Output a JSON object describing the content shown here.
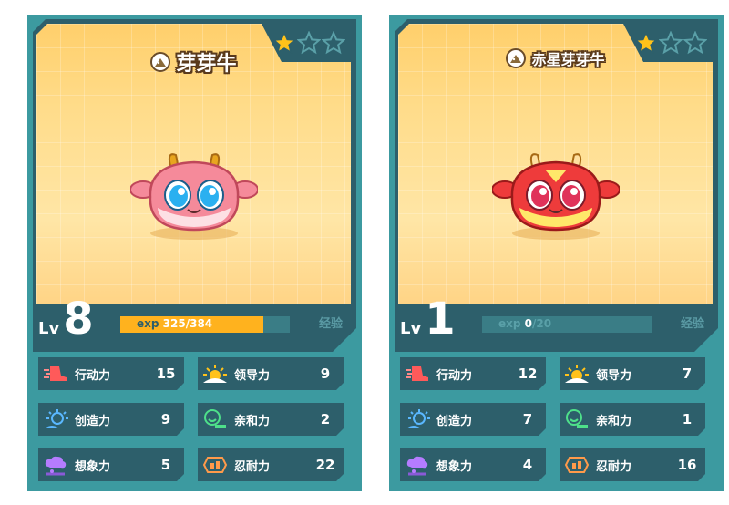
{
  "cards": [
    {
      "name": "芽芽牛",
      "stars_filled": 1,
      "stars_total": 3,
      "level_label": "Lv",
      "level": "8",
      "exp_label": "exp",
      "exp_current": "325",
      "exp_max": "/384",
      "exp_fraction": 0.846,
      "exp_tag": "经验",
      "pet_colors": {
        "body": "#f58a9a",
        "belly": "#fde0e4",
        "eye": "#2ab0f0"
      },
      "stats": [
        {
          "label": "行动力",
          "value": "15",
          "icon": "running-shoe-icon"
        },
        {
          "label": "领导力",
          "value": "9",
          "icon": "sunrise-icon"
        },
        {
          "label": "创造力",
          "value": "9",
          "icon": "lightbulb-icon"
        },
        {
          "label": "亲和力",
          "value": "2",
          "icon": "smile-face-icon"
        },
        {
          "label": "想象力",
          "value": "5",
          "icon": "thought-cloud-icon"
        },
        {
          "label": "忍耐力",
          "value": "22",
          "icon": "endurance-icon"
        }
      ]
    },
    {
      "name": "赤星芽芽牛",
      "stars_filled": 1,
      "stars_total": 3,
      "level_label": "Lv",
      "level": "1",
      "exp_label": "exp",
      "exp_current": "0",
      "exp_max": "/20",
      "exp_fraction": 0,
      "exp_tag": "经验",
      "pet_colors": {
        "body": "#ee3b3b",
        "belly": "#ffe86a",
        "eye": "#e0325a"
      },
      "stats": [
        {
          "label": "行动力",
          "value": "12",
          "icon": "running-shoe-icon"
        },
        {
          "label": "领导力",
          "value": "7",
          "icon": "sunrise-icon"
        },
        {
          "label": "创造力",
          "value": "7",
          "icon": "lightbulb-icon"
        },
        {
          "label": "亲和力",
          "value": "1",
          "icon": "smile-face-icon"
        },
        {
          "label": "想象力",
          "value": "4",
          "icon": "thought-cloud-icon"
        },
        {
          "label": "忍耐力",
          "value": "16",
          "icon": "endurance-icon"
        }
      ]
    }
  ],
  "colors": {
    "accent": "#ffb21e",
    "card_bg": "#3c9aa0",
    "panel": "#2d5f6b"
  }
}
